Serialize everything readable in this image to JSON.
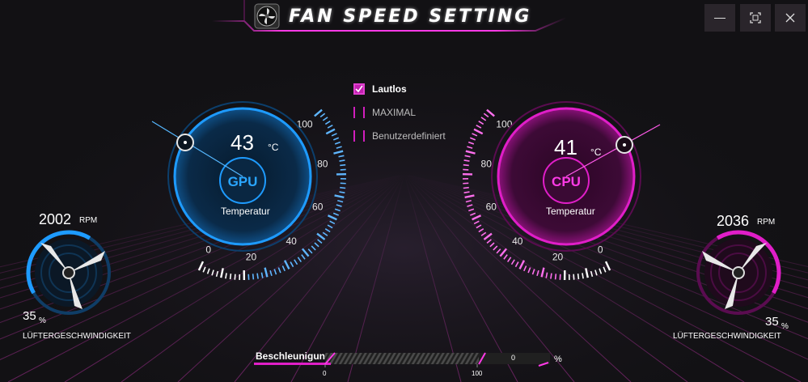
{
  "window": {
    "title": "FAN SPEED SETTING",
    "controls": [
      "minimize",
      "maximize",
      "close"
    ]
  },
  "gpu": {
    "chip_label": "GPU",
    "temperature": "43",
    "temperature_unit": "°C",
    "caption": "Temperatur",
    "gauge_ticks": [
      "0",
      "20",
      "40",
      "60",
      "80",
      "100"
    ],
    "fan_rpm": "2002",
    "rpm_unit": "RPM",
    "fan_percent": "35",
    "percent_unit": "%",
    "fan_label": "LÜFTERGESCHWINDIGKEIT",
    "accent_color": "#1e9bff"
  },
  "cpu": {
    "chip_label": "CPU",
    "temperature": "41",
    "temperature_unit": "°C",
    "caption": "Temperatur",
    "gauge_ticks": [
      "0",
      "20",
      "40",
      "60",
      "80",
      "100"
    ],
    "fan_rpm": "2036",
    "rpm_unit": "RPM",
    "fan_percent": "35",
    "percent_unit": "%",
    "fan_label": "LÜFTERGESCHWINDIGKEIT",
    "accent_color": "#e01ec8"
  },
  "modes": {
    "items": [
      {
        "label": "Lautlos",
        "checked": true
      },
      {
        "label": "MAXIMAL",
        "checked": false
      },
      {
        "label": "Benutzerdefiniert",
        "checked": false
      }
    ]
  },
  "acceleration": {
    "label": "Beschleunigun",
    "value": "0",
    "unit": "%",
    "min_label": "0",
    "max_label": "100"
  }
}
